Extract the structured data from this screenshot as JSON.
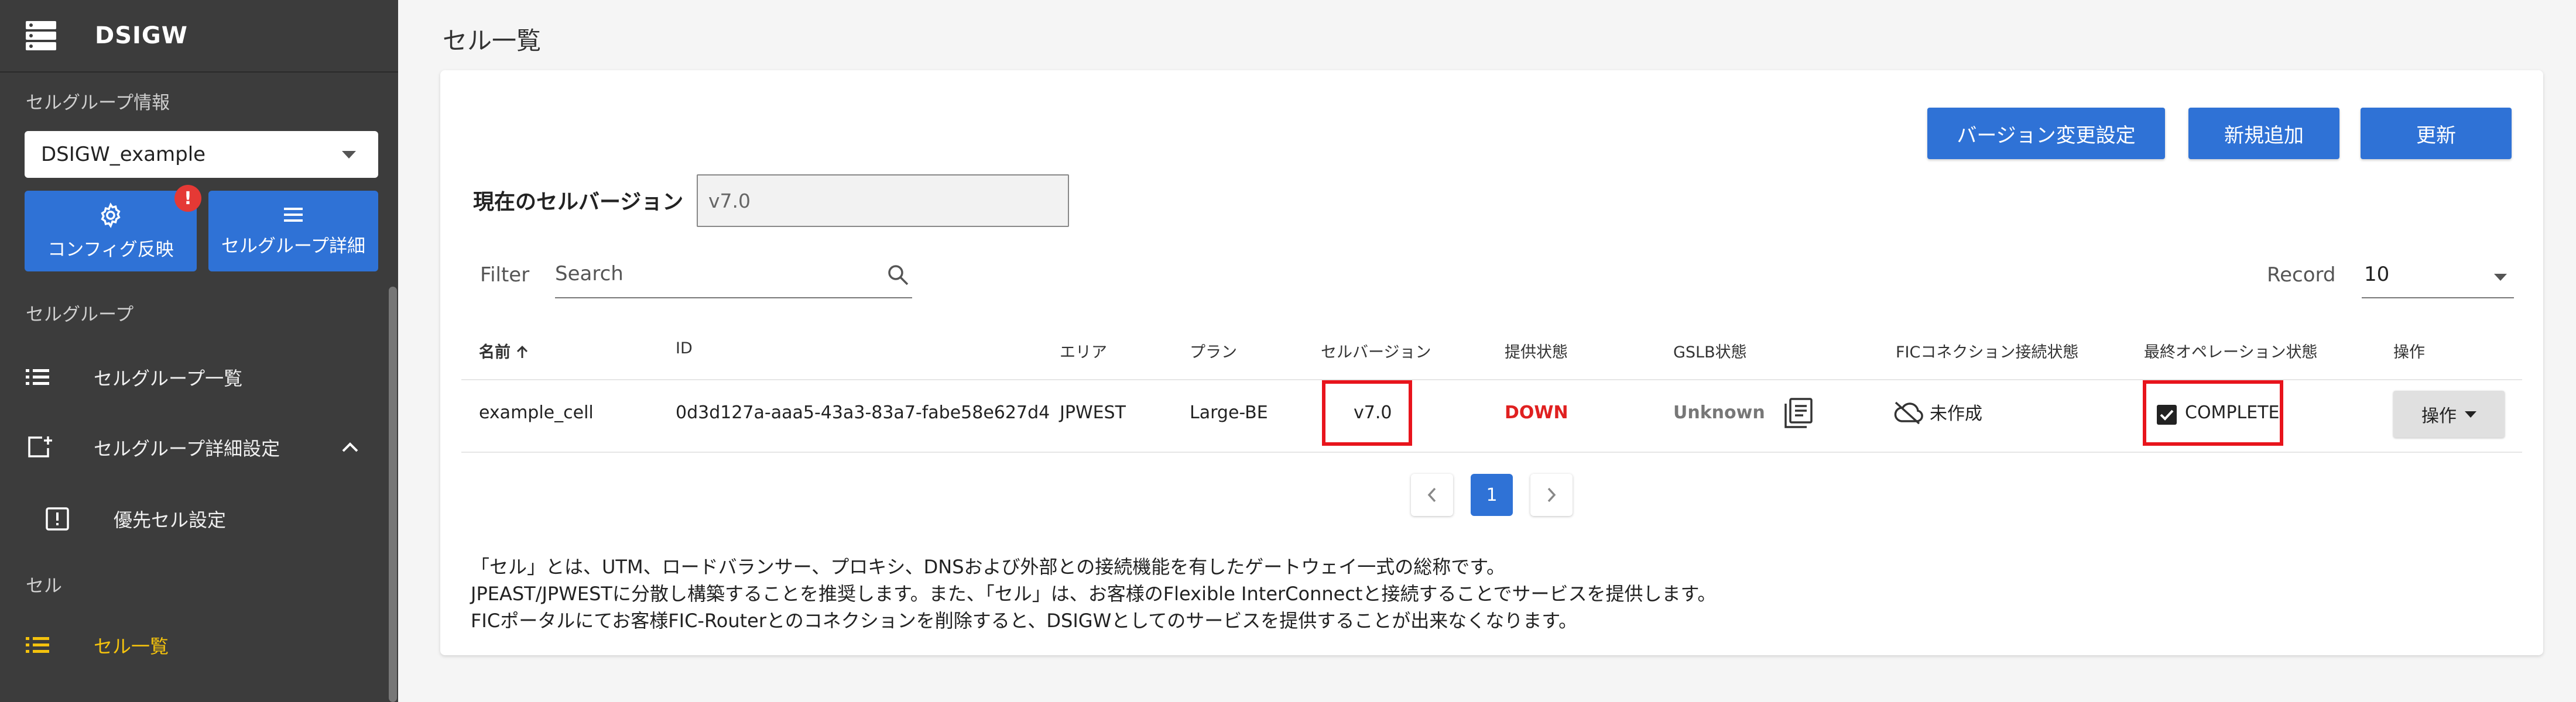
{
  "sidebar": {
    "app_title": "DSIGW",
    "section_cellgroup_info": "セルグループ情報",
    "cellgroup_select": "DSIGW_example",
    "config_button": "コンフィグ反映",
    "config_badge": "!",
    "detail_button": "セルグループ詳細",
    "section_cellgroup": "セルグループ",
    "item_cellgroup_list": "セルグループ一覧",
    "item_cellgroup_detail_settings": "セルグループ詳細設定",
    "item_priority_cell": "優先セル設定",
    "section_cell": "セル",
    "item_cell_list": "セル一覧"
  },
  "main": {
    "page_title": "セル一覧",
    "buttons": {
      "version_change": "バージョン変更設定",
      "add_new": "新規追加",
      "refresh": "更新"
    },
    "current_version_label": "現在のセルバージョン",
    "current_version_value": "v7.0",
    "filter_label": "Filter",
    "search_placeholder": "Search",
    "record_label": "Record",
    "record_value": "10",
    "columns": {
      "name": "名前",
      "id": "ID",
      "area": "エリア",
      "plan": "プラン",
      "cell_version": "セルバージョン",
      "provision_status": "提供状態",
      "gslb_status": "GSLB状態",
      "fic_status": "FICコネクション接続状態",
      "last_operation": "最終オペレーション状態",
      "operation": "操作"
    },
    "row": {
      "name": "example_cell",
      "id": "0d3d127a-aaa5-43a3-83a7-fabe58e627d4",
      "area": "JPWEST",
      "plan": "Large-BE",
      "cell_version": "v7.0",
      "provision_status": "DOWN",
      "gslb_status": "Unknown",
      "fic_status": "未作成",
      "last_operation": "COMPLETE",
      "operation_button": "操作"
    },
    "pagination": {
      "current": "1"
    },
    "notes": [
      "「セル」とは、UTM、ロードバランサー、プロキシ、DNSおよび外部との接続機能を有したゲートウェイ一式の総称です。",
      "JPEAST/JPWESTに分散し構築することを推奨します。また、「セル」は、お客様のFlexible InterConnectと接続することでサービスを提供します。",
      "FICポータルにてお客様FIC-Routerとのコネクションを削除すると、DSIGWとしてのサービスを提供することが出来なくなります。"
    ]
  },
  "colors": {
    "primary": "#2f72d6",
    "sidebar_bg": "#3c3c3c",
    "active_item": "#f4c20d",
    "down": "#e02020",
    "highlight_box": "#e8141c"
  }
}
